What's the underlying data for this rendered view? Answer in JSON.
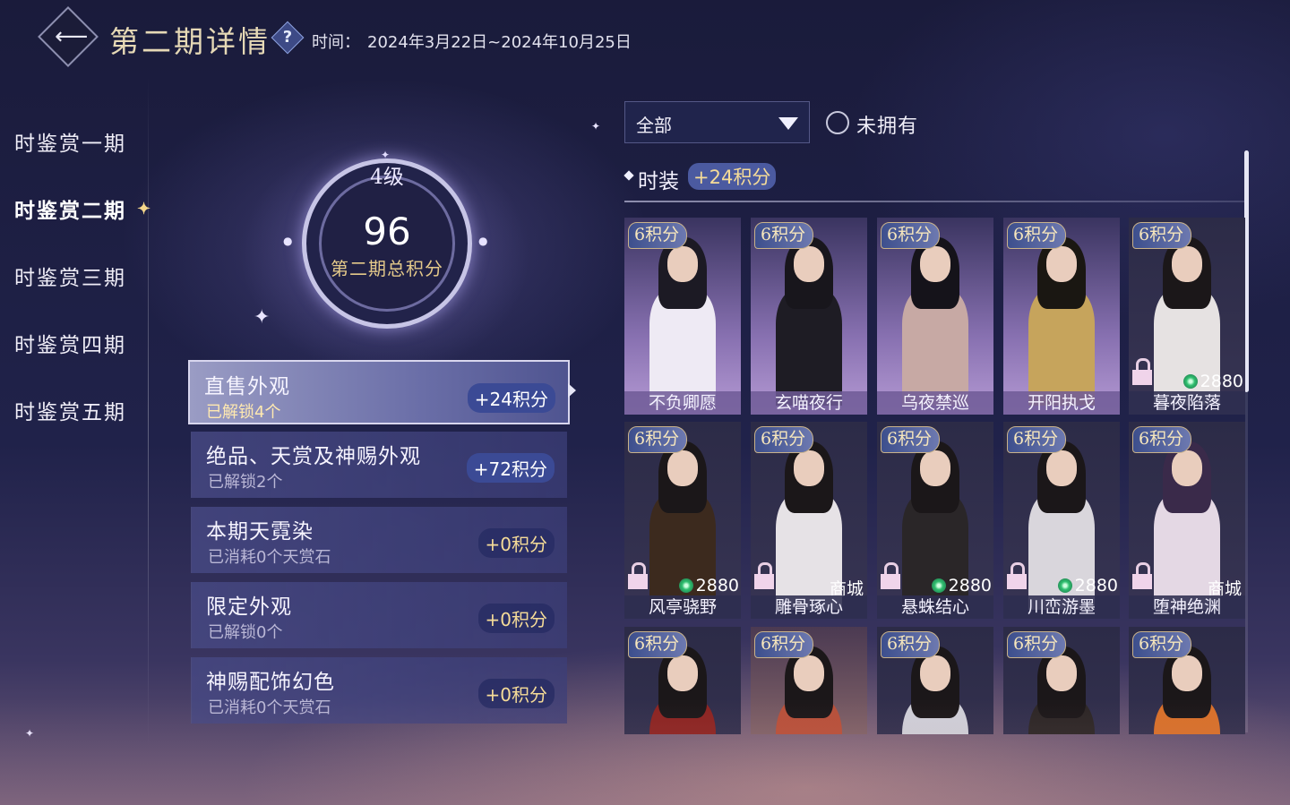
{
  "header": {
    "title": "第二期详情",
    "time_label": "时间：",
    "time_value": "2024年3月22日~2024年10月25日"
  },
  "nav": {
    "items": [
      {
        "label": "时鉴赏一期",
        "active": false
      },
      {
        "label": "时鉴赏二期",
        "active": true
      },
      {
        "label": "时鉴赏三期",
        "active": false
      },
      {
        "label": "时鉴赏四期",
        "active": false
      },
      {
        "label": "时鉴赏五期",
        "active": false
      }
    ]
  },
  "score": {
    "level": "4级",
    "total": "96",
    "caption": "第二期总积分"
  },
  "categories": [
    {
      "title": "直售外观",
      "sub": "已解锁4个",
      "points": "+24积分",
      "active": true
    },
    {
      "title": "绝品、天赏及神赐外观",
      "sub": "已解锁2个",
      "points": "+72积分",
      "active": false
    },
    {
      "title": "本期天霓染",
      "sub": "已消耗0个天赏石",
      "points": "+0积分",
      "active": false
    },
    {
      "title": "限定外观",
      "sub": "已解锁0个",
      "points": "+0积分",
      "active": false
    },
    {
      "title": "神赐配饰幻色",
      "sub": "已消耗0个天赏石",
      "points": "+0积分",
      "active": false
    }
  ],
  "filter": {
    "selected": "全部",
    "unowned_label": "未拥有",
    "unowned_checked": false
  },
  "section": {
    "title": "时装",
    "points": "+24积分"
  },
  "items": [
    {
      "pts": "6积分",
      "name": "不负卿愿",
      "locked": false,
      "price": "",
      "shop": "",
      "bg": "purple",
      "outfit": "#eeeaf4",
      "hair": "#1c1a24"
    },
    {
      "pts": "6积分",
      "name": "玄喵夜行",
      "locked": false,
      "price": "",
      "shop": "",
      "bg": "purple",
      "outfit": "#1e1c24",
      "hair": "#18161c"
    },
    {
      "pts": "6积分",
      "name": "乌夜禁巡",
      "locked": false,
      "price": "",
      "shop": "",
      "bg": "purple",
      "outfit": "#c7a9a4",
      "hair": "#15131a"
    },
    {
      "pts": "6积分",
      "name": "开阳执戈",
      "locked": false,
      "price": "",
      "shop": "",
      "bg": "purple",
      "outfit": "#c6a45c",
      "hair": "#1a1712"
    },
    {
      "pts": "6积分",
      "name": "暮夜陷落",
      "locked": true,
      "price": "2880",
      "shop": "",
      "bg": "dark",
      "outfit": "#e6e2e2",
      "hair": "#1b1719"
    },
    {
      "pts": "6积分",
      "name": "风亭骁野",
      "locked": true,
      "price": "2880",
      "shop": "",
      "bg": "dark",
      "outfit": "#3c2a1e",
      "hair": "#1b1719"
    },
    {
      "pts": "6积分",
      "name": "雕骨琢心",
      "locked": true,
      "price": "",
      "shop": "商城",
      "bg": "dark",
      "outfit": "#e6e2e6",
      "hair": "#1b1719"
    },
    {
      "pts": "6积分",
      "name": "悬蛛结心",
      "locked": true,
      "price": "2880",
      "shop": "",
      "bg": "dark",
      "outfit": "#2a2628",
      "hair": "#1b1719"
    },
    {
      "pts": "6积分",
      "name": "川峦游墨",
      "locked": true,
      "price": "2880",
      "shop": "",
      "bg": "dark",
      "outfit": "#d9d6dc",
      "hair": "#1b1719"
    },
    {
      "pts": "6积分",
      "name": "堕神绝渊",
      "locked": true,
      "price": "",
      "shop": "商城",
      "bg": "dark",
      "outfit": "#e4d8e4",
      "hair": "#3a2a4a"
    },
    {
      "pts": "6积分",
      "name": "",
      "locked": false,
      "price": "",
      "shop": "",
      "bg": "dark",
      "outfit": "#8c2422",
      "hair": "#1b1719"
    },
    {
      "pts": "6积分",
      "name": "",
      "locked": false,
      "price": "",
      "shop": "",
      "bg": "gold",
      "outfit": "#b8503a",
      "hair": "#1b1719"
    },
    {
      "pts": "6积分",
      "name": "",
      "locked": false,
      "price": "",
      "shop": "",
      "bg": "dark",
      "outfit": "#cfcfd8",
      "hair": "#1b1719"
    },
    {
      "pts": "6积分",
      "name": "",
      "locked": false,
      "price": "",
      "shop": "",
      "bg": "dark",
      "outfit": "#2c2626",
      "hair": "#1b1719"
    },
    {
      "pts": "6积分",
      "name": "",
      "locked": false,
      "price": "",
      "shop": "",
      "bg": "dark",
      "outfit": "#d8702a",
      "hair": "#1b1719"
    }
  ]
}
